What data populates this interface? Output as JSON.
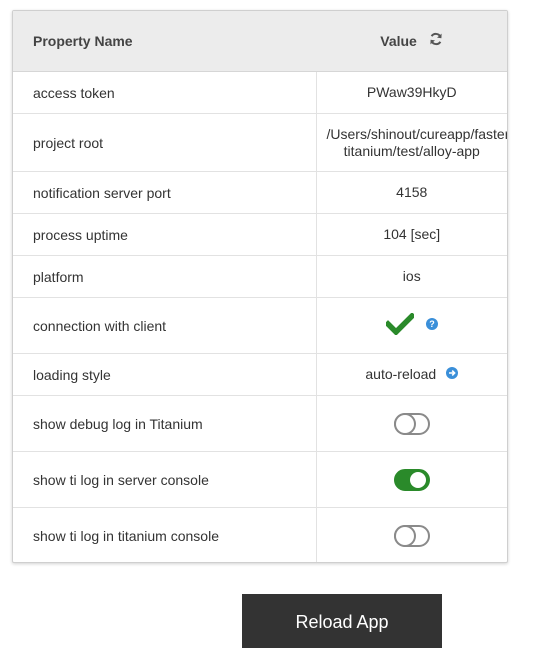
{
  "table": {
    "header_name": "Property Name",
    "header_value": "Value",
    "rows": [
      {
        "name": "access token",
        "value": "PWaw39HkyD"
      },
      {
        "name": "project root",
        "value": "/Users/shinout/cureapp/faster-titanium/test/alloy-app"
      },
      {
        "name": "notification server port",
        "value": "4158"
      },
      {
        "name": "process uptime",
        "value": "104 [sec]"
      },
      {
        "name": "platform",
        "value": "ios"
      },
      {
        "name": "connection with client",
        "value_icon": "checkmark-icon",
        "help_icon": "question-icon"
      },
      {
        "name": "loading style",
        "value": "auto-reload",
        "action_icon": "arrow-right-circle-icon"
      },
      {
        "name": "show debug log in Titanium",
        "toggle": false
      },
      {
        "name": "show ti log in server console",
        "toggle": true
      },
      {
        "name": "show ti log in titanium console",
        "toggle": false
      }
    ]
  },
  "reload_button": "Reload App",
  "colors": {
    "accent_green": "#2a8a2a",
    "info_blue": "#3a8fd9",
    "button_dark": "#333333",
    "header_bg": "#ececec"
  }
}
